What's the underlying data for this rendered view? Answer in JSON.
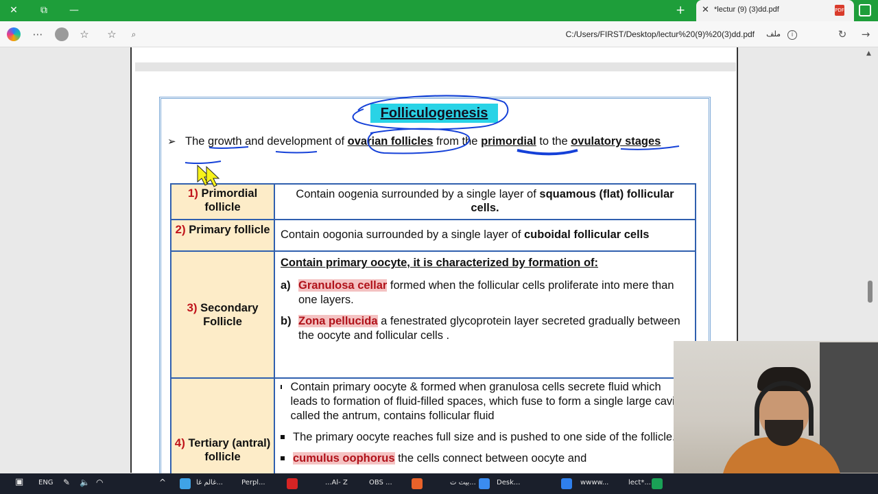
{
  "window": {
    "tab_title": "*lectur (9) (3)dd.pdf",
    "close_glyph": "✕",
    "new_tab_glyph": "+"
  },
  "address": {
    "url": "C:/Users/FIRST/Desktop/lectur%20(9)%20(3)dd.pdf",
    "file_label": "ملف"
  },
  "document": {
    "heading": "Folliculogenesis",
    "intro_pre": "The growth and development of ",
    "intro_b1": "ovarian follicles",
    "intro_mid": " from the ",
    "intro_b2": "primordial",
    "intro_mid2": " to the ",
    "intro_b3": "ovulatory stages",
    "rows": [
      {
        "num": "1)",
        "label": "Primordial follicle",
        "text_pre": "Contain oogenia surrounded by a single layer of ",
        "text_bold": "squamous (flat) follicular cells."
      },
      {
        "num": "2)",
        "label": "Primary follicle",
        "text_pre": "Contain oogonia surrounded by a single layer of ",
        "text_bold": "cuboidal follicular cells"
      },
      {
        "num": "3)",
        "label": "Secondary Follicle",
        "lead": "Contain primary oocyte, it is characterized by formation of:",
        "a_marker": "a)",
        "a_term": "Granulosa cellar",
        "a_text": " formed when the follicular cells proliferate into mere than one layers.",
        "b_marker": "b)",
        "b_term": "Zona pellucida",
        "b_text": " a fenestrated glycoprotein layer secreted gradually between the oocyte and follicular cells ."
      },
      {
        "num": "4)",
        "label": "Tertiary (antral) follicle",
        "bullet1": "Contain primary oocyte & formed when granulosa cells secrete fluid which leads to formation of fluid-filled spaces, which fuse to form a single large cavity called the antrum, contains follicular fluid",
        "bullet2": "The primary oocyte reaches full size and is pushed to one side of the follicle.",
        "bullet3_term": "cumulus oophorus",
        "bullet3_text": " the cells connect between oocyte and"
      }
    ]
  },
  "taskbar": {
    "lang": "ENG",
    "items": [
      "غالم غا...",
      "Perpl...",
      "...Al- Z",
      "OBS ...",
      "بيت ت...",
      "Desk...",
      "wwww...",
      "lect*..."
    ]
  },
  "colors": {
    "titlebar": "#1e9e3a",
    "heading_highlight": "#29d3e6",
    "table_border": "#2f5fae",
    "label_bg": "#fdecc8",
    "term_highlight": "#f4c2c2",
    "annotation_ink": "#1440d8"
  }
}
